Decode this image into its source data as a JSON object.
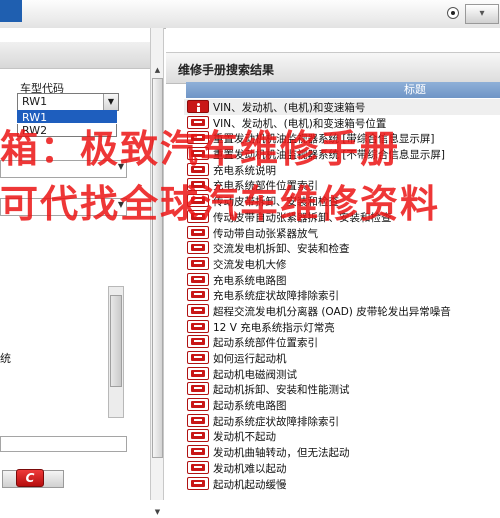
{
  "left": {
    "model_label": "车型代码",
    "selected": "RW1",
    "options": [
      "RW1",
      "RW2"
    ],
    "partial_text": "统"
  },
  "right": {
    "title": "维修手册搜索结果",
    "column_header": "标题",
    "items": [
      "VIN、发动机、(电机)和变速箱号",
      "VIN、发动机、(电机)和变速箱号位置",
      "重置发动机机油监视器系统 [带综合信息显示屏]",
      "重置发动机机油监视器系统 [不带综合信息显示屏]",
      "充电系统说明",
      "充电系统部件位置索引",
      "传动皮带拆卸、安装和检查",
      "传动皮带自动张紧器拆卸、安装和检查",
      "传动带自动张紧器放气",
      "交流发电机拆卸、安装和检查",
      "交流发电机大修",
      "充电系统电路图",
      "充电系统症状故障排除索引",
      "超程交流发电机分离器 (OAD) 皮带轮发出异常噪音",
      "12 V 充电系统指示灯常亮",
      "起动系统部件位置索引",
      "如何运行起动机",
      "起动机电磁阀测试",
      "起动机拆卸、安装和性能测试",
      "起动系统电路图",
      "起动系统症状故障排除索引",
      "发动机不起动",
      "发动机曲轴转动，但无法起动",
      "发动机难以起动",
      "起动机起动缓慢"
    ]
  },
  "watermark": {
    "line1": "箱：极致汽车维修手册",
    "line2": "可代找全球汽车维修资料"
  }
}
